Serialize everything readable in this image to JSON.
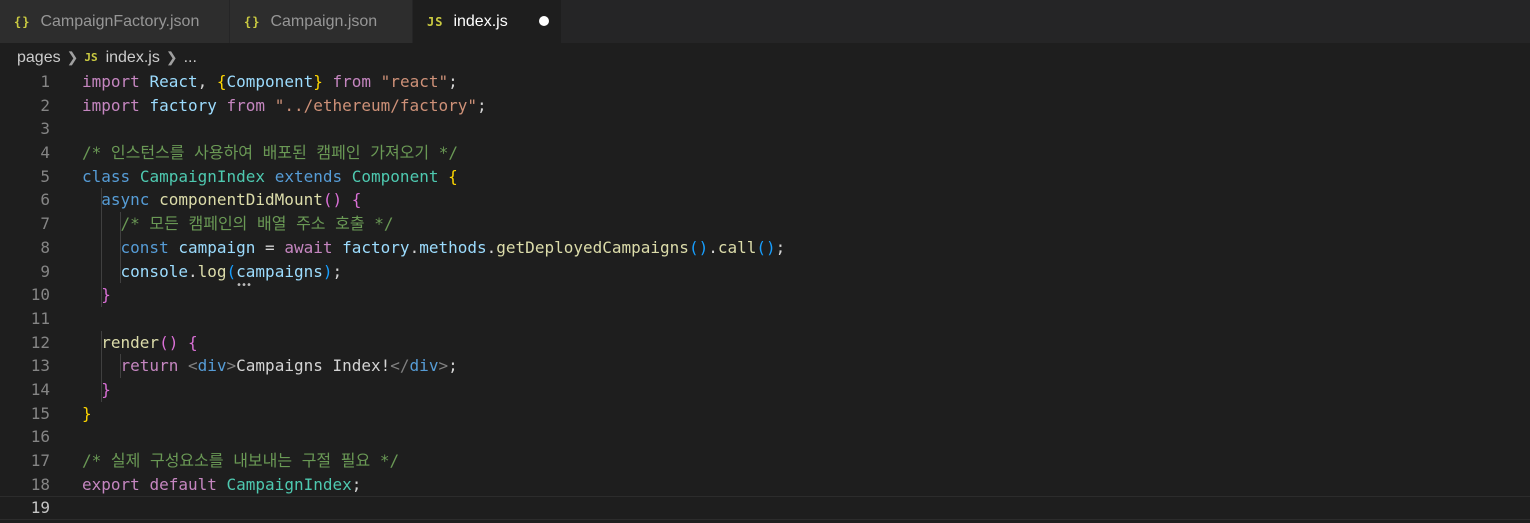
{
  "tabs": [
    {
      "label": "CampaignFactory.json",
      "icon": "{}",
      "icon_name": "json-file-icon",
      "active": false
    },
    {
      "label": "Campaign.json",
      "icon": "{}",
      "icon_name": "json-file-icon",
      "active": false
    },
    {
      "label": "index.js",
      "icon": "JS",
      "icon_name": "js-file-icon",
      "active": true,
      "unsaved": true
    }
  ],
  "breadcrumb": {
    "folder": "pages",
    "file_icon": "JS",
    "file": "index.js",
    "more": "..."
  },
  "editor": {
    "current_line": 19,
    "colors": {
      "keyword": "#c586c0",
      "storage": "#569cd6",
      "class": "#4ec9b0",
      "function": "#dcdcaa",
      "variable": "#9cdcfe",
      "string": "#ce9178",
      "comment": "#6a9955",
      "plain": "#d4d4d4",
      "brace1": "#ffd700",
      "brace2": "#da70d6",
      "brace3": "#179fff",
      "tag_bracket": "#808080"
    },
    "lines": [
      {
        "num": "1",
        "tokens": [
          [
            "import",
            "keyword"
          ],
          [
            " ",
            "plain"
          ],
          [
            "React",
            "variable"
          ],
          [
            ", ",
            "plain"
          ],
          [
            "{",
            "brace1"
          ],
          [
            "Component",
            "variable"
          ],
          [
            "}",
            "brace1"
          ],
          [
            " ",
            "plain"
          ],
          [
            "from",
            "keyword"
          ],
          [
            " ",
            "plain"
          ],
          [
            "\"react\"",
            "string"
          ],
          [
            ";",
            "plain"
          ]
        ]
      },
      {
        "num": "2",
        "tokens": [
          [
            "import",
            "keyword"
          ],
          [
            " ",
            "plain"
          ],
          [
            "factory",
            "variable"
          ],
          [
            " ",
            "plain"
          ],
          [
            "from",
            "keyword"
          ],
          [
            " ",
            "plain"
          ],
          [
            "\"../ethereum/factory\"",
            "string"
          ],
          [
            ";",
            "plain"
          ]
        ]
      },
      {
        "num": "3",
        "tokens": []
      },
      {
        "num": "4",
        "tokens": [
          [
            "/* 인스턴스를 사용하여 배포된 캠페인 가져오기 */",
            "comment"
          ]
        ]
      },
      {
        "num": "5",
        "tokens": [
          [
            "class",
            "storage"
          ],
          [
            " ",
            "plain"
          ],
          [
            "CampaignIndex",
            "class"
          ],
          [
            " ",
            "plain"
          ],
          [
            "extends",
            "storage"
          ],
          [
            " ",
            "plain"
          ],
          [
            "Component",
            "class"
          ],
          [
            " ",
            "plain"
          ],
          [
            "{",
            "brace1"
          ]
        ]
      },
      {
        "num": "6",
        "tokens": [
          [
            "  ",
            "plain"
          ],
          [
            "async",
            "storage"
          ],
          [
            " ",
            "plain"
          ],
          [
            "componentDidMount",
            "function"
          ],
          [
            "()",
            "brace2"
          ],
          [
            " ",
            "plain"
          ],
          [
            "{",
            "brace2"
          ]
        ]
      },
      {
        "num": "7",
        "tokens": [
          [
            "    ",
            "plain"
          ],
          [
            "/* 모든 캠페인의 배열 주소 호출 */",
            "comment"
          ]
        ]
      },
      {
        "num": "8",
        "tokens": [
          [
            "    ",
            "plain"
          ],
          [
            "const",
            "storage"
          ],
          [
            " ",
            "plain"
          ],
          [
            "campaign",
            "variable"
          ],
          [
            " = ",
            "plain"
          ],
          [
            "await",
            "keyword"
          ],
          [
            " ",
            "plain"
          ],
          [
            "factory",
            "variable"
          ],
          [
            ".",
            "plain"
          ],
          [
            "methods",
            "variable"
          ],
          [
            ".",
            "plain"
          ],
          [
            "getDeployedCampaigns",
            "function"
          ],
          [
            "()",
            "brace3"
          ],
          [
            ".",
            "plain"
          ],
          [
            "call",
            "function"
          ],
          [
            "()",
            "brace3"
          ],
          [
            ";",
            "plain"
          ]
        ]
      },
      {
        "num": "9",
        "tokens": [
          [
            "    ",
            "plain"
          ],
          [
            "console",
            "variable"
          ],
          [
            ".",
            "plain"
          ],
          [
            "log",
            "function"
          ],
          [
            "(",
            "brace3"
          ],
          [
            "campaigns",
            "variable"
          ],
          [
            ")",
            "brace3"
          ],
          [
            ";",
            "plain"
          ]
        ]
      },
      {
        "num": "10",
        "tokens": [
          [
            "  ",
            "plain"
          ],
          [
            "}",
            "brace2"
          ]
        ]
      },
      {
        "num": "11",
        "tokens": []
      },
      {
        "num": "12",
        "tokens": [
          [
            "  ",
            "plain"
          ],
          [
            "render",
            "function"
          ],
          [
            "()",
            "brace2"
          ],
          [
            " ",
            "plain"
          ],
          [
            "{",
            "brace2"
          ]
        ]
      },
      {
        "num": "13",
        "tokens": [
          [
            "    ",
            "plain"
          ],
          [
            "return",
            "keyword"
          ],
          [
            " ",
            "plain"
          ],
          [
            "<",
            "tag_bracket"
          ],
          [
            "div",
            "storage"
          ],
          [
            ">",
            "tag_bracket"
          ],
          [
            "Campaigns Index!",
            "plain"
          ],
          [
            "</",
            "tag_bracket"
          ],
          [
            "div",
            "storage"
          ],
          [
            ">",
            "tag_bracket"
          ],
          [
            ";",
            "plain"
          ]
        ]
      },
      {
        "num": "14",
        "tokens": [
          [
            "  ",
            "plain"
          ],
          [
            "}",
            "brace2"
          ]
        ]
      },
      {
        "num": "15",
        "tokens": [
          [
            "}",
            "brace1"
          ]
        ]
      },
      {
        "num": "16",
        "tokens": []
      },
      {
        "num": "17",
        "tokens": [
          [
            "/* 실제 구성요소를 내보내는 구절 필요 */",
            "comment"
          ]
        ]
      },
      {
        "num": "18",
        "tokens": [
          [
            "export",
            "keyword"
          ],
          [
            " ",
            "plain"
          ],
          [
            "default",
            "keyword"
          ],
          [
            " ",
            "plain"
          ],
          [
            "CampaignIndex",
            "class"
          ],
          [
            ";",
            "plain"
          ]
        ]
      },
      {
        "num": "19",
        "tokens": []
      }
    ]
  }
}
